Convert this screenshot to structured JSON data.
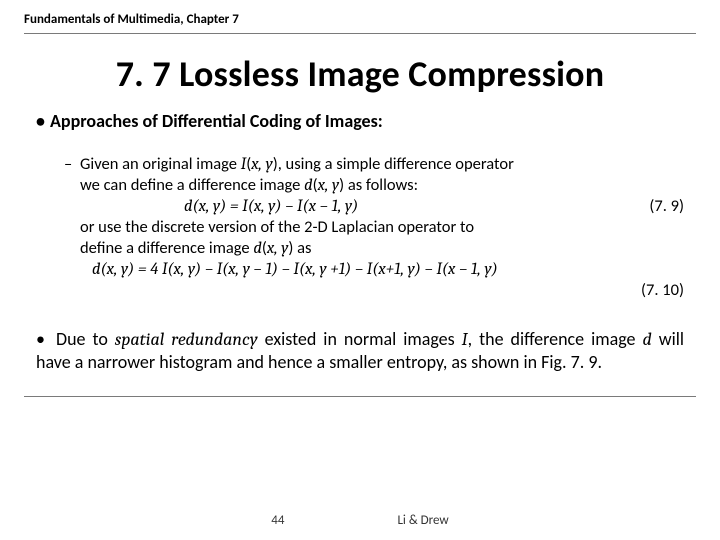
{
  "header": "Fundamentals of Multimedia, Chapter 7",
  "title": "7. 7 Lossless Image Compression",
  "bullet1": "Approaches of Differential Coding of Images:",
  "sub": {
    "line1a": "Given an original image ",
    "line1b": "I",
    "line1c": "(",
    "line1d": "x, y",
    "line1e": "), using a simple difference operator",
    "line2a": "we can define a difference image ",
    "line2b": "d",
    "line2c": "(",
    "line2d": "x, y",
    "line2e": ") as follows:",
    "eq1": "d(x, y) = I(x, y) − I(x − 1, y)",
    "eq1num": "(7. 9)",
    "line3": "or use the discrete version of the 2-D Laplacian operator to",
    "line4a": "define a difference image ",
    "line4b": "d",
    "line4c": "(",
    "line4d": "x, y",
    "line4e": ") as",
    "eq2": "d(x, y) = 4 I(x, y) − I(x, y − 1) − I(x, y +1) − I(x+1, y) − I(x − 1, y)",
    "eq2num": "(7. 10)"
  },
  "bullet2": {
    "a": "Due to ",
    "b": "spatial redundancy",
    "c": " existed in normal images ",
    "d": "I",
    "e": ", the difference image ",
    "f": "d",
    "g": " will have a narrower histogram and hence a smaller entropy, as shown in Fig. 7. 9."
  },
  "footer": {
    "page": "44",
    "authors": "Li & Drew"
  }
}
